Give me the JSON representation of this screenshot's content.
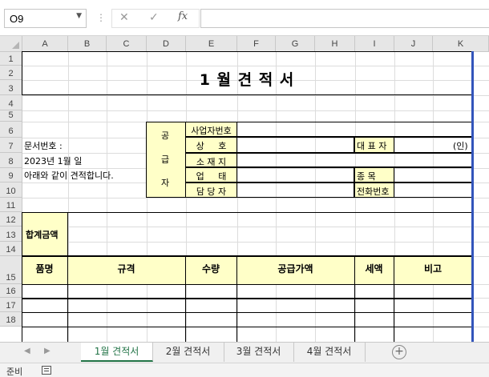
{
  "formula_bar": {
    "name_box": "O9",
    "separator": "⋮",
    "cancel_icon": "✕",
    "enter_icon": "✓",
    "fx_label": "fx",
    "formula_value": ""
  },
  "columns": [
    "A",
    "B",
    "C",
    "D",
    "E",
    "F",
    "G",
    "H",
    "I",
    "J",
    "K"
  ],
  "rows": [
    "1",
    "2",
    "3",
    "4",
    "5",
    "6",
    "7",
    "8",
    "9",
    "10",
    "11",
    "12",
    "13",
    "14",
    "15",
    "16",
    "17",
    "18"
  ],
  "sheet": {
    "title": "1 월 견 적 서",
    "doc_no": "문서번호 :",
    "date": "2023년 1월 일",
    "note": "아래와 같이 견적합니다.",
    "supplier_chars": [
      "공",
      "급",
      "자"
    ],
    "supplier_labels": [
      "사업자번호",
      "상     호",
      "소 재 지",
      "업     태",
      "담 당 자"
    ],
    "rep_label": "대 표 자",
    "seal": "(인)",
    "item_label": "종     목",
    "phone_label": "전화번호",
    "total_label": "합계금액",
    "table_headers": [
      "품명",
      "규격",
      "수량",
      "공급가액",
      "세액",
      "비고"
    ]
  },
  "tabs": [
    "1월 견적서",
    "2월 견적서",
    "3월 견적서",
    "4월 견적서"
  ],
  "active_tab": 0,
  "status": {
    "ready": "준비"
  },
  "colors": {
    "accent": "#217346",
    "header_fill": "#ffffc8",
    "selection_border": "#1e3ea0"
  }
}
